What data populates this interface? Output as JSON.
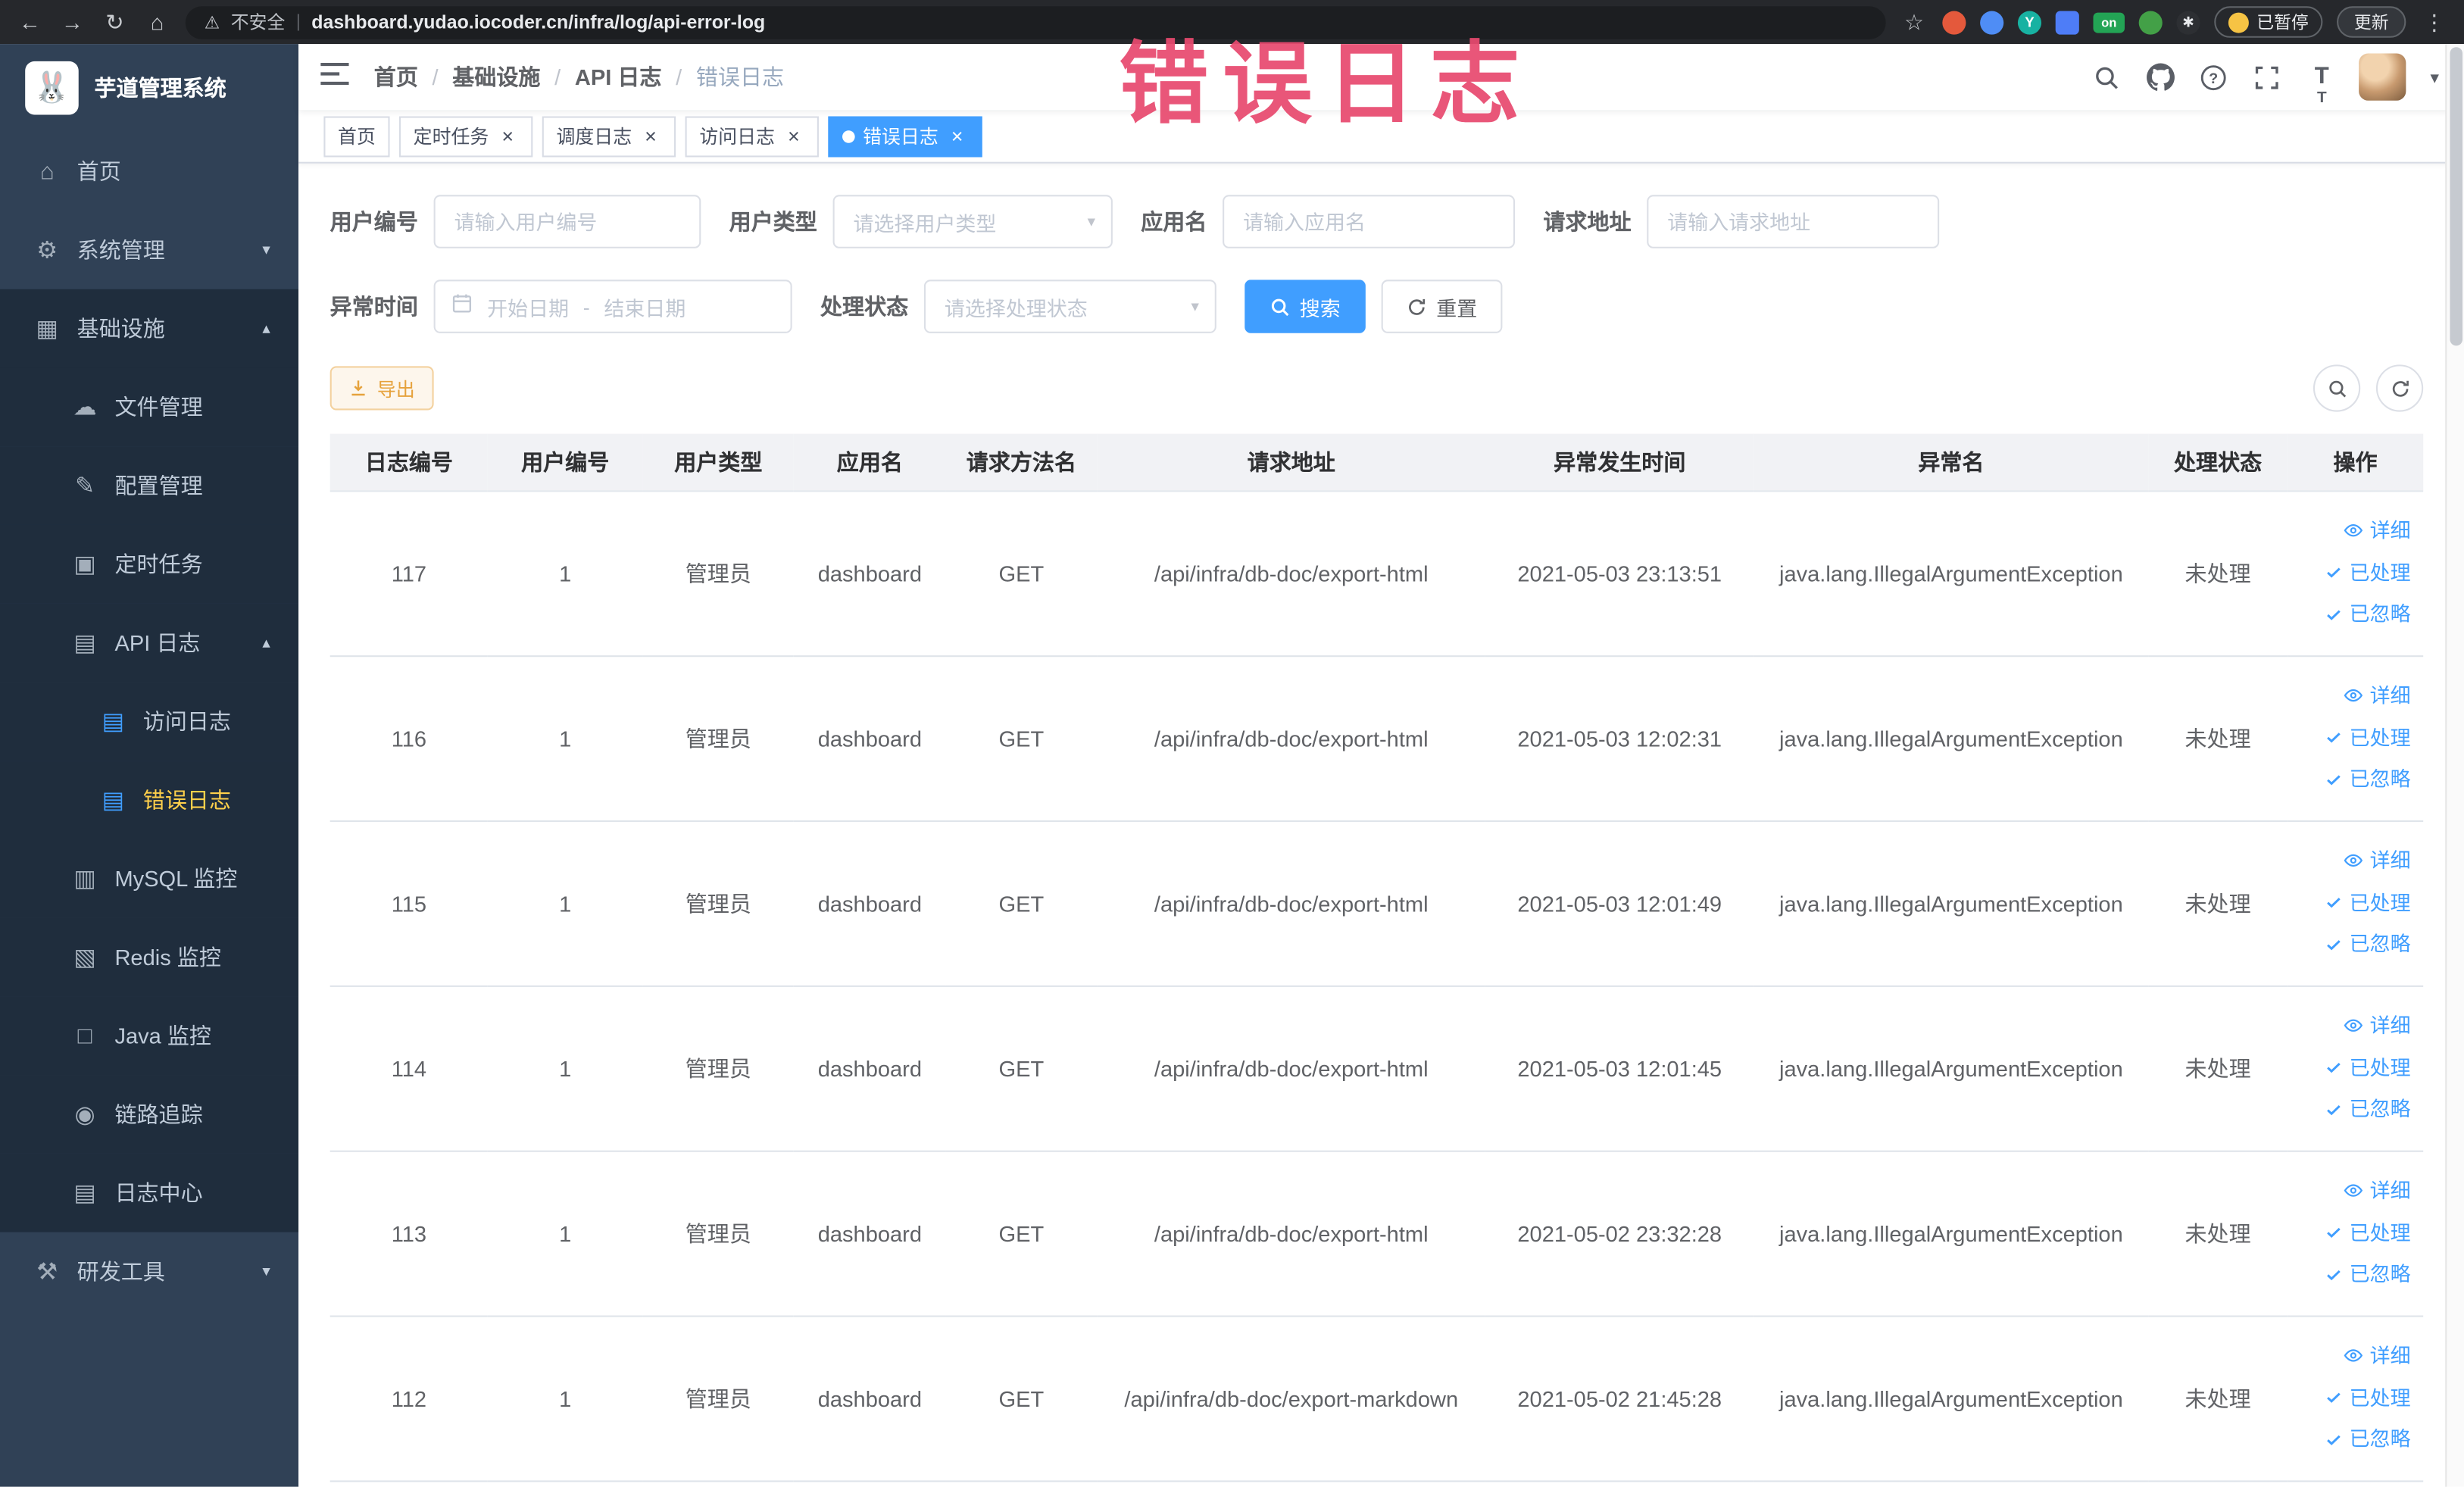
{
  "browser": {
    "security_label": "不安全",
    "url": "dashboard.yudao.iocoder.cn/infra/log/api-error-log",
    "paused_badge": "已暂停",
    "update_button": "更新",
    "extensions": {
      "y_badge": "Y",
      "on_badge": "on"
    }
  },
  "annotation": {
    "text": "错误日志"
  },
  "sidebar": {
    "logo_title": "芋道管理系统",
    "menu": [
      {
        "label": "首页",
        "icon": "dashboard-icon",
        "level": 1
      },
      {
        "label": "系统管理",
        "icon": "gear-icon",
        "level": 1,
        "chevron": "down"
      },
      {
        "label": "基础设施",
        "icon": "grid-icon",
        "level": 1,
        "chevron": "up",
        "expanded": true
      },
      {
        "label": "文件管理",
        "icon": "cloud-icon",
        "level": 2
      },
      {
        "label": "配置管理",
        "icon": "edit-icon",
        "level": 2
      },
      {
        "label": "定时任务",
        "icon": "schedule-icon",
        "level": 2
      },
      {
        "label": "API 日志",
        "icon": "document-icon",
        "level": 2,
        "chevron": "up",
        "expanded": true
      },
      {
        "label": "访问日志",
        "icon": "document-icon",
        "level": 3
      },
      {
        "label": "错误日志",
        "icon": "document-icon",
        "level": 3,
        "active": true
      },
      {
        "label": "MySQL 监控",
        "icon": "database-icon",
        "level": 2
      },
      {
        "label": "Redis 监控",
        "icon": "layers-icon",
        "level": 2
      },
      {
        "label": "Java 监控",
        "icon": "monitor-icon",
        "level": 2
      },
      {
        "label": "链路追踪",
        "icon": "eye-icon",
        "level": 2
      },
      {
        "label": "日志中心",
        "icon": "document-icon",
        "level": 2
      },
      {
        "label": "研发工具",
        "icon": "tools-icon",
        "level": 1,
        "chevron": "down"
      }
    ]
  },
  "header": {
    "breadcrumb": [
      "首页",
      "基础设施",
      "API 日志",
      "错误日志"
    ]
  },
  "tabs": [
    {
      "label": "首页",
      "closable": false,
      "active": false
    },
    {
      "label": "定时任务",
      "closable": true,
      "active": false
    },
    {
      "label": "调度日志",
      "closable": true,
      "active": false
    },
    {
      "label": "访问日志",
      "closable": true,
      "active": false
    },
    {
      "label": "错误日志",
      "closable": true,
      "active": true
    }
  ],
  "filters": {
    "user_id_label": "用户编号",
    "user_id_placeholder": "请输入用户编号",
    "user_type_label": "用户类型",
    "user_type_placeholder": "请选择用户类型",
    "app_name_label": "应用名",
    "app_name_placeholder": "请输入应用名",
    "request_url_label": "请求地址",
    "request_url_placeholder": "请输入请求地址",
    "exception_time_label": "异常时间",
    "start_date_placeholder": "开始日期",
    "end_date_placeholder": "结束日期",
    "date_separator": "-",
    "process_status_label": "处理状态",
    "process_status_placeholder": "请选择处理状态",
    "search_button": "搜索",
    "reset_button": "重置"
  },
  "toolbar": {
    "export_button": "导出"
  },
  "table": {
    "headers": [
      "日志编号",
      "用户编号",
      "用户类型",
      "应用名",
      "请求方法名",
      "请求地址",
      "异常发生时间",
      "异常名",
      "处理状态",
      "操作"
    ],
    "actions": {
      "detail": "详细",
      "processed": "已处理",
      "ignored": "已忽略"
    },
    "rows": [
      {
        "id": "117",
        "user_id": "1",
        "user_type": "管理员",
        "app": "dashboard",
        "method": "GET",
        "url": "/api/infra/db-doc/export-html",
        "time": "2021-05-03 23:13:51",
        "exception": "java.lang.IllegalArgumentException",
        "status": "未处理"
      },
      {
        "id": "116",
        "user_id": "1",
        "user_type": "管理员",
        "app": "dashboard",
        "method": "GET",
        "url": "/api/infra/db-doc/export-html",
        "time": "2021-05-03 12:02:31",
        "exception": "java.lang.IllegalArgumentException",
        "status": "未处理"
      },
      {
        "id": "115",
        "user_id": "1",
        "user_type": "管理员",
        "app": "dashboard",
        "method": "GET",
        "url": "/api/infra/db-doc/export-html",
        "time": "2021-05-03 12:01:49",
        "exception": "java.lang.IllegalArgumentException",
        "status": "未处理"
      },
      {
        "id": "114",
        "user_id": "1",
        "user_type": "管理员",
        "app": "dashboard",
        "method": "GET",
        "url": "/api/infra/db-doc/export-html",
        "time": "2021-05-03 12:01:45",
        "exception": "java.lang.IllegalArgumentException",
        "status": "未处理"
      },
      {
        "id": "113",
        "user_id": "1",
        "user_type": "管理员",
        "app": "dashboard",
        "method": "GET",
        "url": "/api/infra/db-doc/export-html",
        "time": "2021-05-02 23:32:28",
        "exception": "java.lang.IllegalArgumentException",
        "status": "未处理"
      },
      {
        "id": "112",
        "user_id": "1",
        "user_type": "管理员",
        "app": "dashboard",
        "method": "GET",
        "url": "/api/infra/db-doc/export-markdown",
        "time": "2021-05-02 21:45:28",
        "exception": "java.lang.IllegalArgumentException",
        "status": "未处理"
      }
    ]
  },
  "colors": {
    "primary": "#409eff",
    "warning": "#e6a23c",
    "sidebar_bg": "#304156",
    "sidebar_submenu_bg": "#1f2d3d",
    "active_menu_text": "#ffd04b",
    "annotation_red": "#e84a6f"
  }
}
